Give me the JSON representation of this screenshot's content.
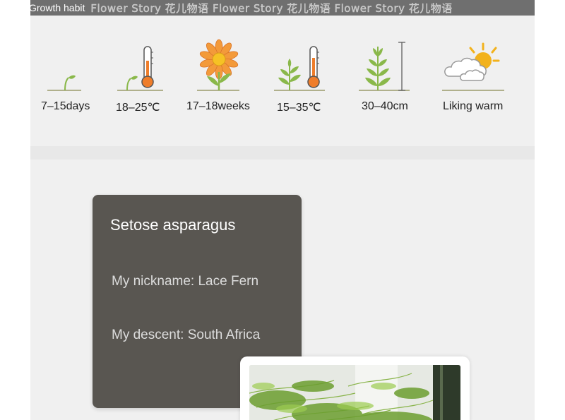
{
  "header": {
    "title": "Growth habit",
    "watermark": "Flower Story 花儿物语 Flower Story 花儿物语 Flower Story 花儿物语"
  },
  "habits": [
    {
      "label": "7–15days",
      "icon": "sprout-icon"
    },
    {
      "label": "18–25℃",
      "icon": "sprout-thermometer-icon"
    },
    {
      "label": "17–18weeks",
      "icon": "flower-icon"
    },
    {
      "label": "15–35℃",
      "icon": "plant-thermometer-icon"
    },
    {
      "label": "30–40cm",
      "icon": "plant-height-icon"
    },
    {
      "label": "Liking warm",
      "icon": "sun-cloud-icon"
    }
  ],
  "card": {
    "title": "Setose asparagus",
    "nickname": "My nickname: Lace Fern",
    "descent": "My descent:  South Africa"
  },
  "photo": {
    "icon": "plant-photo"
  },
  "colors": {
    "header_bg": "#6f6f6f",
    "panel_bg": "#f0f0f0",
    "card_bg": "#595651",
    "leaf_green": "#8ab84a",
    "thermo_orange": "#ef7d2a",
    "sun_yellow": "#f2b21c"
  }
}
